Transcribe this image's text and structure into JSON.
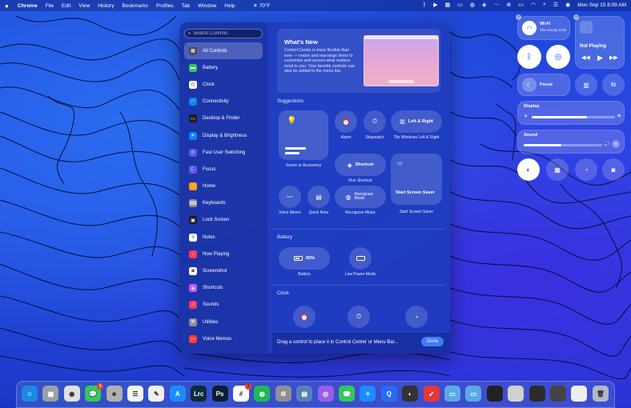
{
  "menubar": {
    "app": "Chrome",
    "menus": [
      "File",
      "Edit",
      "View",
      "History",
      "Bookmarks",
      "Profiles",
      "Tab",
      "Window",
      "Help"
    ],
    "weather": "70°F",
    "clock": "Mon Sep 15  8:09 AM"
  },
  "editor": {
    "search_placeholder": "Search Controls",
    "sidebar": [
      {
        "label": "All Controls",
        "icon": "grid-icon",
        "color": "#4a4a55"
      },
      {
        "label": "Battery",
        "icon": "battery-icon",
        "color": "#34c759"
      },
      {
        "label": "Clock",
        "icon": "clock-icon",
        "color": "#ffffff"
      },
      {
        "label": "Connectivity",
        "icon": "wifi-icon",
        "color": "#0a84ff"
      },
      {
        "label": "Desktop & Finder",
        "icon": "desktop-icon",
        "color": "#1c1c1e"
      },
      {
        "label": "Display & Brightness",
        "icon": "brightness-icon",
        "color": "#0a84ff"
      },
      {
        "label": "Fast User Switching",
        "icon": "user-icon",
        "color": "#5e5ce6"
      },
      {
        "label": "Focus",
        "icon": "moon-icon",
        "color": "#5e5ce6"
      },
      {
        "label": "Home",
        "icon": "home-icon",
        "color": "#ff9f0a"
      },
      {
        "label": "Keyboards",
        "icon": "keyboard-icon",
        "color": "#8e8e93"
      },
      {
        "label": "Lock Screen",
        "icon": "lock-icon",
        "color": "#1c1c1e"
      },
      {
        "label": "Notes",
        "icon": "notes-icon",
        "color": "#ffffff"
      },
      {
        "label": "Now Playing",
        "icon": "music-icon",
        "color": "#ff375f"
      },
      {
        "label": "Screenshot",
        "icon": "camera-icon",
        "color": "#ffffff"
      },
      {
        "label": "Shortcuts",
        "icon": "shortcuts-icon",
        "color": "#bf5af2"
      },
      {
        "label": "Sounds",
        "icon": "speaker-icon",
        "color": "#ff375f"
      },
      {
        "label": "Utilities",
        "icon": "tools-icon",
        "color": "#8e8e93"
      },
      {
        "label": "Voice Memos",
        "icon": "waveform-icon",
        "color": "#ff3b30"
      }
    ],
    "whats_new": {
      "title": "What's New",
      "description": "Control Center is more flexible than ever — resize and rearrange items to customize and access what matters most to you. Your favorite controls can also be added to the menu bar."
    },
    "suggestions_title": "Suggestions",
    "suggestions": {
      "scene": "Scene or Accessory",
      "alarm": "Alarm",
      "stopwatch": "Stopwatch",
      "tile_windows_label": "Left & Right",
      "tile_windows": "Tile Windows Left & Right",
      "shortcut_label": "Shortcut",
      "run_shortcut": "Run Shortcut",
      "start_screen_saver_label": "Start Screen Saver",
      "start_screen_saver": "Start Screen Saver",
      "voice_memo": "Voice Memo",
      "quick_note": "Quick Note",
      "recognize_music_label": "Recognize Music",
      "recognize_music": "Recognize Music"
    },
    "battery_title": "Battery",
    "battery": {
      "percent": "65%",
      "level": 0.65,
      "label": "Battery",
      "low_power": "Low Power Mode"
    },
    "clock_title": "Clock",
    "footer_hint": "Drag a control to place it in Control Center or Menu Bar...",
    "done": "Done"
  },
  "control_center": {
    "wifi_title": "Wi-Fi",
    "wifi_network": "The Krusty Krab",
    "now_playing": "Not Playing",
    "focus": "Focus",
    "display": "Display",
    "display_level": 0.66,
    "sound": "Sound",
    "sound_level": 0.48
  },
  "dock": {
    "apps": [
      {
        "name": "finder",
        "label": "☺",
        "color": "#1e88e5"
      },
      {
        "name": "launchpad",
        "label": "▦",
        "color": "#9aa0a6"
      },
      {
        "name": "chrome",
        "label": "◉",
        "color": "#e0e0e0"
      },
      {
        "name": "messages",
        "label": "💬",
        "color": "#34c759",
        "badge": "1"
      },
      {
        "name": "contacts",
        "label": "☻",
        "color": "#b0b0b0"
      },
      {
        "name": "reminders",
        "label": "☰",
        "color": "#f5f5f5"
      },
      {
        "name": "notes",
        "label": "✎",
        "color": "#f0f0f0"
      },
      {
        "name": "app-store",
        "label": "A",
        "color": "#1a8cff"
      },
      {
        "name": "lightroom",
        "label": "Lrc",
        "color": "#0f2a3a"
      },
      {
        "name": "photoshop",
        "label": "Ps",
        "color": "#0a1f33"
      },
      {
        "name": "slack",
        "label": "#",
        "color": "#ffffff",
        "badge": "3"
      },
      {
        "name": "spotify",
        "label": "◍",
        "color": "#1db954"
      },
      {
        "name": "system-settings",
        "label": "⚙",
        "color": "#8e8e93"
      },
      {
        "name": "preview",
        "label": "▤",
        "color": "#5a7fb5"
      },
      {
        "name": "podcasts",
        "label": "◎",
        "color": "#9b5de5"
      },
      {
        "name": "facetime",
        "label": "☎",
        "color": "#34c759"
      },
      {
        "name": "safari",
        "label": "✧",
        "color": "#1a8cff"
      },
      {
        "name": "quicktime",
        "label": "Q",
        "color": "#2a6cf0"
      },
      {
        "name": "davinci",
        "label": "◐",
        "color": "#333333"
      },
      {
        "name": "rocket",
        "label": "➶",
        "color": "#e53935"
      },
      {
        "name": "folder-1",
        "label": "▭",
        "color": "#5aa9e6"
      },
      {
        "name": "folder-2",
        "label": "▭",
        "color": "#5aa9e6"
      },
      {
        "name": "screenshot-1",
        "label": "",
        "color": "#222222"
      },
      {
        "name": "screenshot-2",
        "label": "",
        "color": "#d0d0d0"
      },
      {
        "name": "screenshot-3",
        "label": "",
        "color": "#2b2b2b"
      },
      {
        "name": "screenshot-4",
        "label": "",
        "color": "#444444"
      },
      {
        "name": "screenshot-5",
        "label": "",
        "color": "#eeeeee"
      },
      {
        "name": "trash",
        "label": "🗑",
        "color": "#b0b8c8"
      }
    ]
  }
}
